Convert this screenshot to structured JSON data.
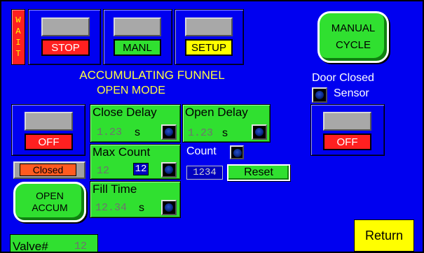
{
  "status": {
    "wait_letters": [
      "W",
      "A",
      "I",
      "T"
    ]
  },
  "top_buttons": {
    "stop": "STOP",
    "manl": "MANL",
    "setup": "SETUP"
  },
  "manual_cycle": {
    "line1": "MANUAL",
    "line2": "CYCLE"
  },
  "title": {
    "line1": "ACCUMULATING FUNNEL",
    "line2": "OPEN MODE"
  },
  "door": {
    "line1": "Door Closed",
    "line2": "Sensor",
    "state": "OFF"
  },
  "left": {
    "state": "OFF",
    "status": "Closed",
    "open_line1": "OPEN",
    "open_line2": "ACCUM"
  },
  "close_delay": {
    "label": "Close Delay",
    "value": "1.23",
    "unit": "s"
  },
  "open_delay": {
    "label": "Open Delay",
    "value": "1.23",
    "unit": "s"
  },
  "max_count": {
    "label": "Max Count",
    "value": "12",
    "setpoint": "12"
  },
  "fill_time": {
    "label": "Fill Time",
    "value": "12.34",
    "unit": "s"
  },
  "count": {
    "label": "Count",
    "value": "1234",
    "reset": "Reset"
  },
  "valve": {
    "label": "Valve#",
    "value": "12"
  },
  "footer": {
    "return": "Return"
  },
  "colors": {
    "background": "#0000f0",
    "green": "#30e030",
    "red": "#ff2020",
    "yellow": "#ffff00"
  }
}
